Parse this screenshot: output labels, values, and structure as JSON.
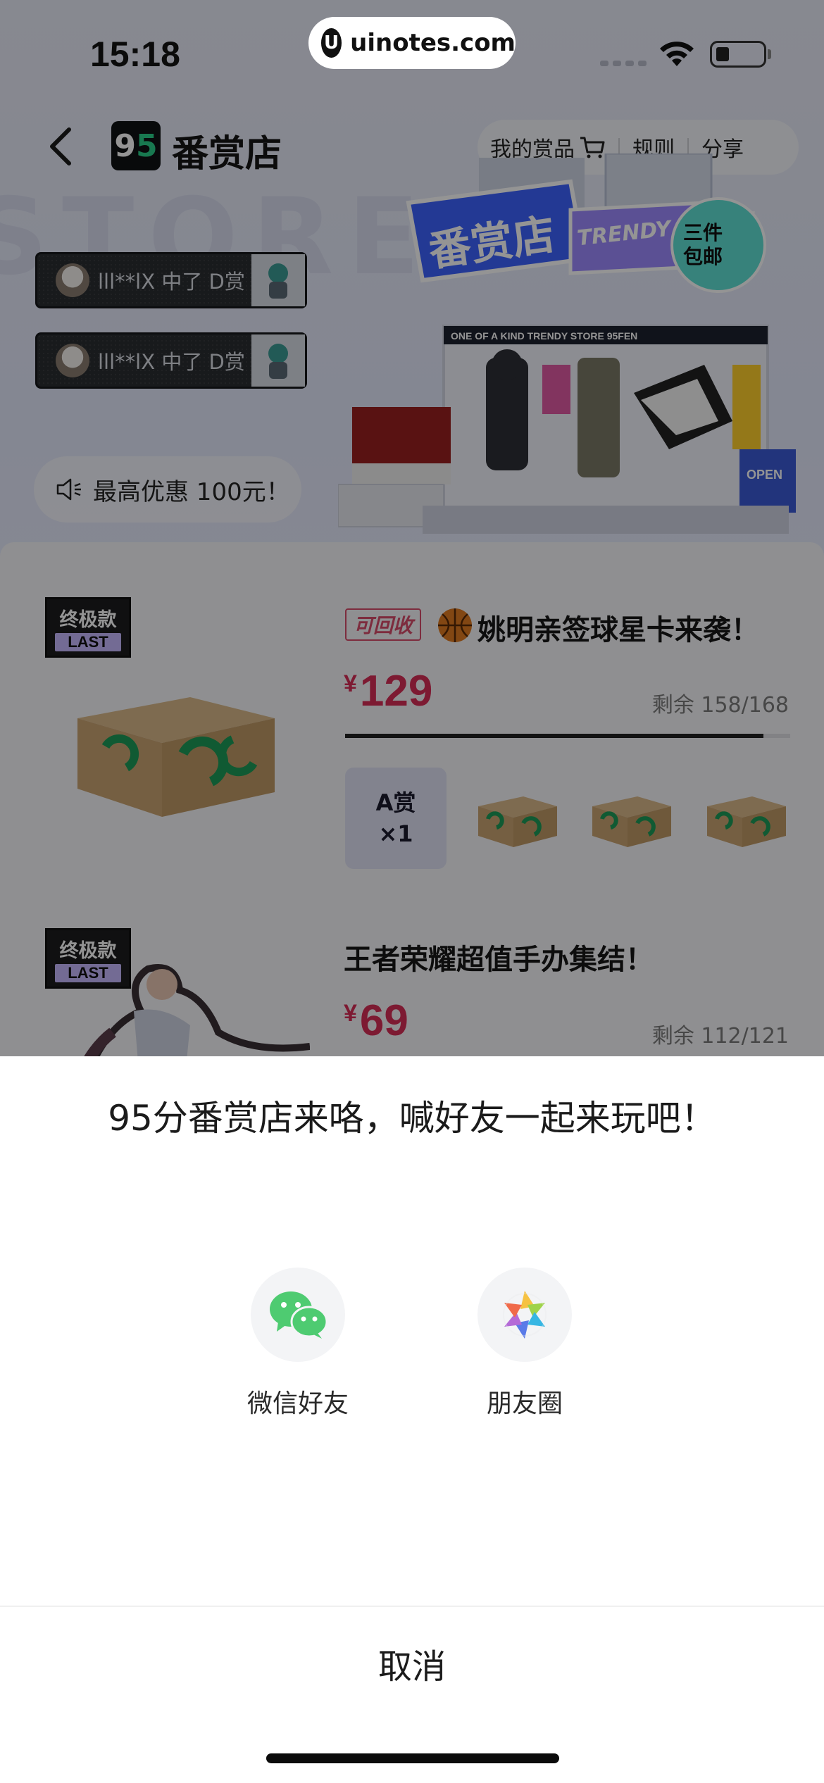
{
  "status_bar": {
    "time": "15:18"
  },
  "watermark": {
    "text": "uinotes.com",
    "logo": "U"
  },
  "nav": {
    "title": "番赏店",
    "logo_nine": "9",
    "logo_five": "5",
    "my_prizes": "我的赏品",
    "rules": "规则",
    "share": "分享"
  },
  "tickers": [
    {
      "text": "lll**lX 中了 D赏"
    },
    {
      "text": "lll**lX 中了 D赏"
    }
  ],
  "promo": {
    "text": "最高优惠 100元！"
  },
  "store_art": {
    "sign_text": "番赏店",
    "sign_sub": "TRENDY STORE",
    "badge": "三件包邮",
    "banner": "ONE OF A KIND    TRENDY STORE    95FEN",
    "open_sign": "OPEN"
  },
  "products": [
    {
      "badge_top": "终极款",
      "badge_bottom": "LAST",
      "tag": "可回收",
      "title": "姚明亲签球星卡来袭！",
      "currency": "¥",
      "price": "129",
      "remaining": "剩余 158/168",
      "remaining_fraction": 0.94,
      "prize_label_1": "A赏",
      "prize_label_2": "×1"
    },
    {
      "badge_top": "终极款",
      "badge_bottom": "LAST",
      "title": "王者荣耀超值手办集结！",
      "currency": "¥",
      "price": "69",
      "remaining": "剩余 112/121"
    }
  ],
  "share_sheet": {
    "title": "95分番赏店来咯，喊好友一起来玩吧！",
    "options": [
      {
        "label": "微信好友",
        "icon": "wechat-icon"
      },
      {
        "label": "朋友圈",
        "icon": "moments-icon"
      }
    ],
    "cancel": "取消"
  }
}
